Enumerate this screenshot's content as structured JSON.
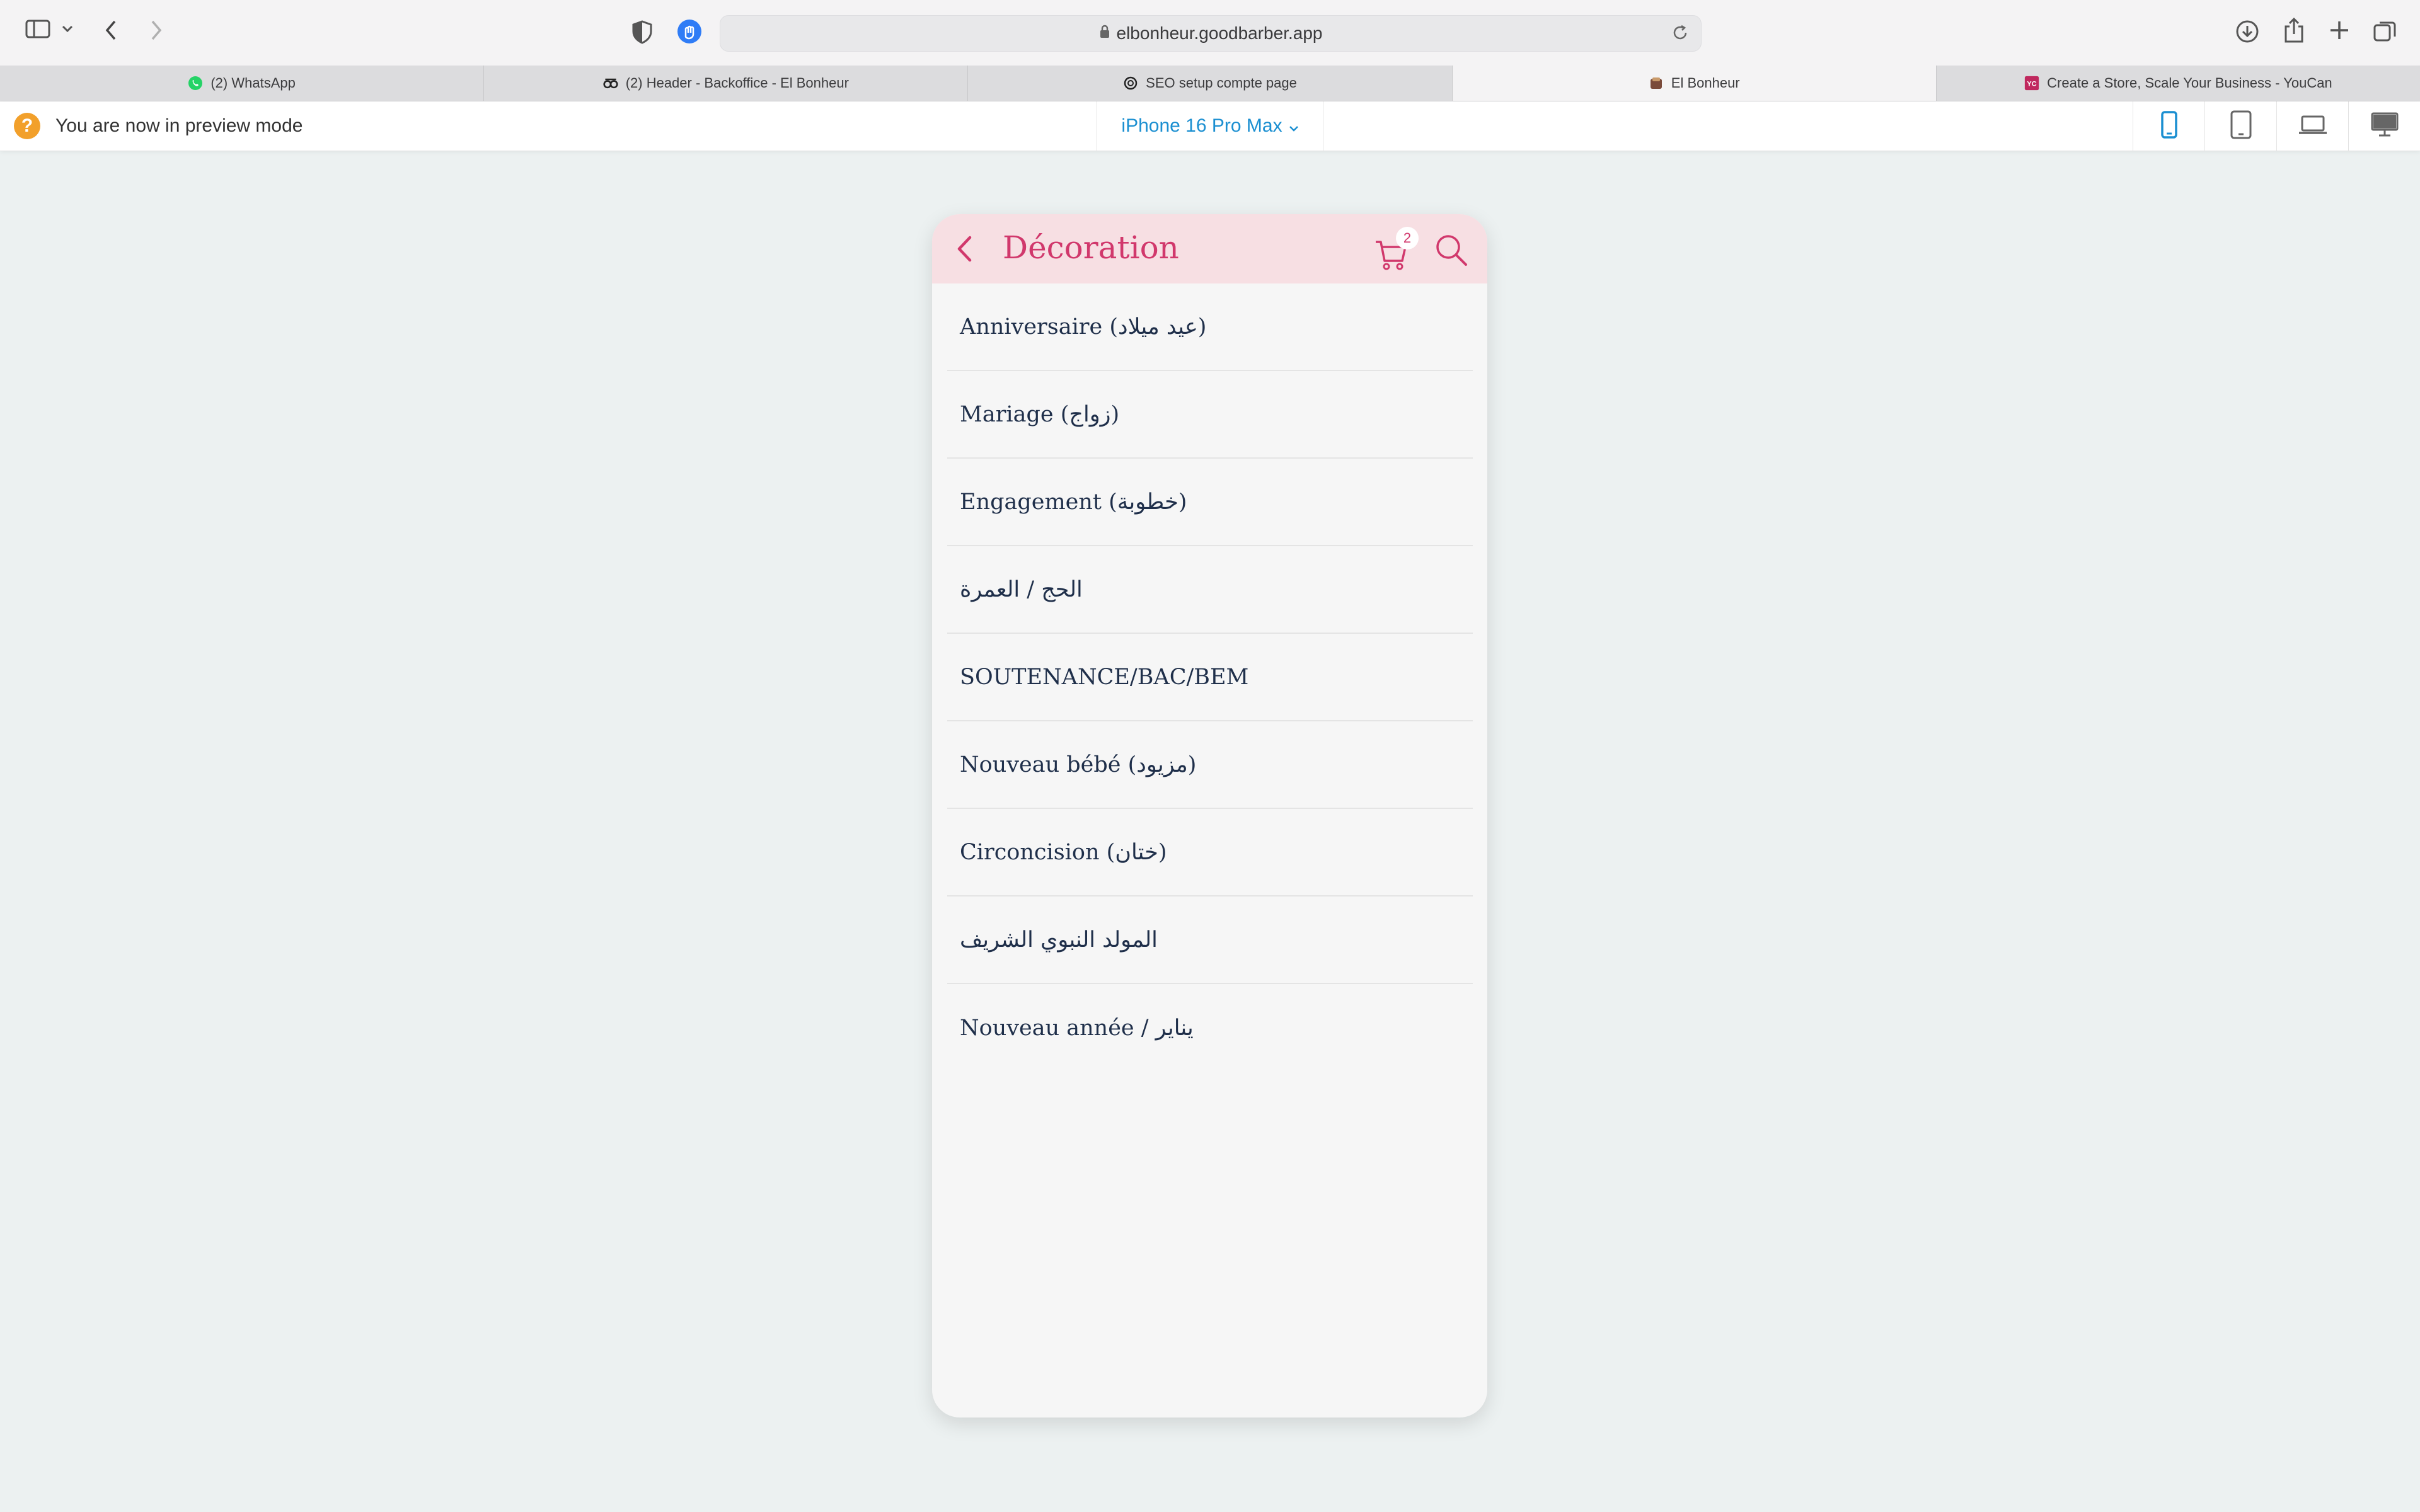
{
  "browser": {
    "url": "elbonheur.goodbarber.app",
    "tabs": [
      {
        "label": "(2) WhatsApp",
        "icon": "whatsapp-icon",
        "active": false
      },
      {
        "label": "(2) Header - Backoffice - El Bonheur",
        "icon": "goodbarber-icon",
        "active": false
      },
      {
        "label": "SEO setup compte page",
        "icon": "chatgpt-icon",
        "active": false
      },
      {
        "label": "El Bonheur",
        "icon": "elbonheur-icon",
        "active": true
      },
      {
        "label": "Create a Store, Scale Your Business - YouCan",
        "icon": "youcan-icon",
        "active": false
      }
    ]
  },
  "preview": {
    "notice": "You are now in preview mode",
    "device": "iPhone 16 Pro Max",
    "devices": [
      "phone-icon",
      "tablet-icon",
      "laptop-icon",
      "desktop-icon"
    ],
    "selected_device": "phone-icon"
  },
  "app": {
    "title": "Décoration",
    "cart_count": "2",
    "colors": {
      "accent": "#d1386c",
      "header_bg": "#f7dfe3",
      "text": "#1f2f4a"
    },
    "items": [
      {
        "label": "Anniversaire (عيد ميلاد)"
      },
      {
        "label": "Mariage (زواج)"
      },
      {
        "label": "Engagement (خطوبة)"
      },
      {
        "label": "الحج / العمرة"
      },
      {
        "label": "SOUTENANCE/BAC/BEM"
      },
      {
        "label": "Nouveau bébé (مزيود)"
      },
      {
        "label": "Circoncision (ختان)"
      },
      {
        "label": "المولد النبوي الشريف"
      },
      {
        "label": "يناير / Nouveau année"
      }
    ]
  }
}
